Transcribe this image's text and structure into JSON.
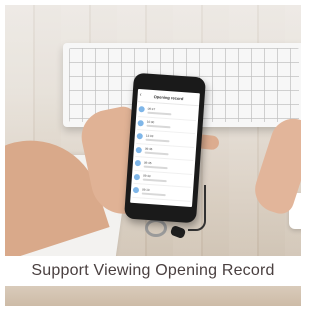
{
  "app_screen": {
    "title": "Opening record",
    "records": [
      {
        "time": "09:47"
      },
      {
        "time": "10:00"
      },
      {
        "time": "13:03"
      },
      {
        "time": "09:46"
      },
      {
        "time": "09:45"
      },
      {
        "time": "09:43"
      },
      {
        "time": "09:10"
      }
    ]
  },
  "caption": "Support Viewing Opening Record",
  "icons": {
    "back": "back-arrow-icon",
    "avatar": "user-avatar-icon"
  },
  "colors": {
    "caption_text": "#4a4040",
    "avatar": "#7fb6e8",
    "phone_body": "#1a1a1a"
  }
}
